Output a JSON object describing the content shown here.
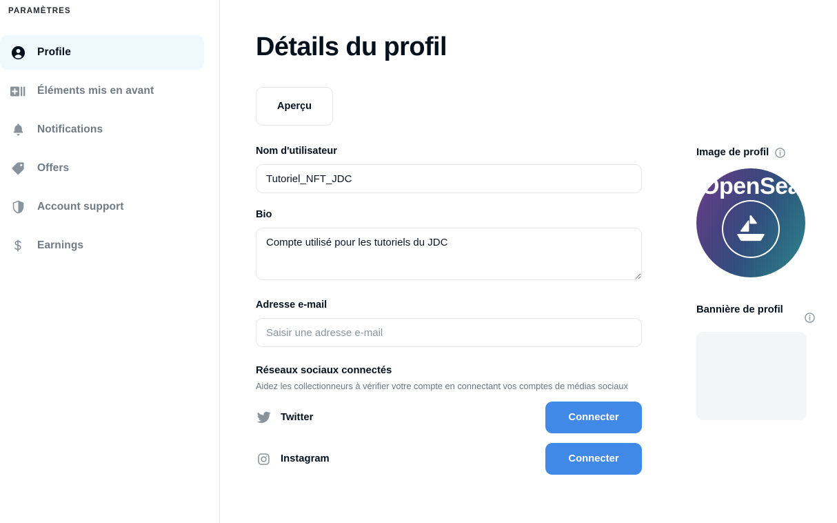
{
  "sidebar": {
    "title": "PARAMÈTRES",
    "items": [
      {
        "label": "Profile",
        "icon": "user-circle-icon",
        "active": true
      },
      {
        "label": "Éléments mis en avant",
        "icon": "featured-items-icon",
        "active": false
      },
      {
        "label": "Notifications",
        "icon": "bell-icon",
        "active": false
      },
      {
        "label": "Offers",
        "icon": "tag-icon",
        "active": false
      },
      {
        "label": "Account support",
        "icon": "shield-icon",
        "active": false
      },
      {
        "label": "Earnings",
        "icon": "dollar-icon",
        "active": false
      }
    ]
  },
  "main": {
    "title": "Détails du profil",
    "preview_button": "Aperçu",
    "username": {
      "label": "Nom d'utilisateur",
      "value": "Tutoriel_NFT_JDC",
      "placeholder": ""
    },
    "bio": {
      "label": "Bio",
      "value": "Compte utilisé pour les tutoriels du JDC",
      "placeholder": ""
    },
    "email": {
      "label": "Adresse e-mail",
      "value": "",
      "placeholder": "Saisir une adresse e-mail"
    },
    "social": {
      "heading": "Réseaux sociaux connectés",
      "description": "Aidez les collectionneurs à vérifier votre compte en connectant vos comptes de médias sociaux",
      "rows": [
        {
          "name": "Twitter",
          "icon": "twitter-icon",
          "button": "Connecter"
        },
        {
          "name": "Instagram",
          "icon": "instagram-icon",
          "button": "Connecter"
        }
      ]
    }
  },
  "right": {
    "profile_image": {
      "label": "Image de profil",
      "info_icon": "info-icon",
      "avatar_brand_text": "OpenSea",
      "avatar_icon": "sailboat-icon"
    },
    "profile_banner": {
      "label": "Bannière de profil",
      "info_icon": "info-icon"
    }
  },
  "colors": {
    "accent_blue": "#4189e6",
    "active_nav_bg": "#eef8fd",
    "text_primary": "#04111d",
    "text_muted": "#707a83",
    "border": "#e5e8eb",
    "placeholder_bg": "#f4f5f7"
  }
}
